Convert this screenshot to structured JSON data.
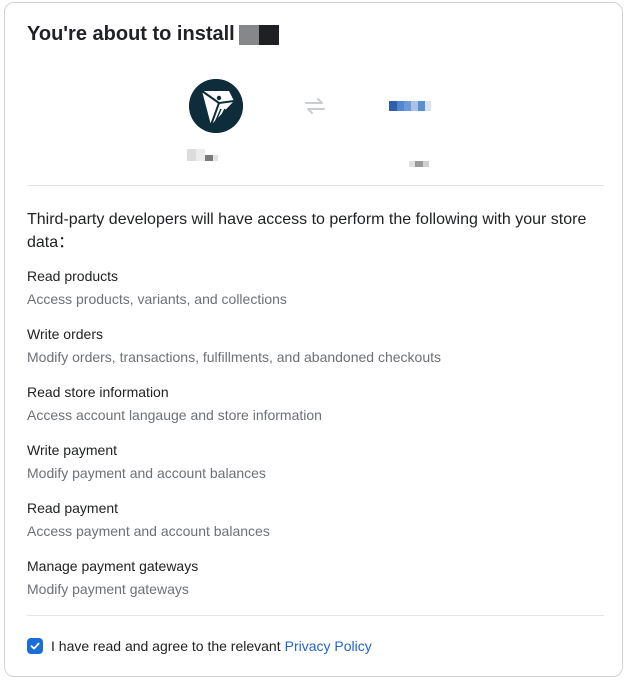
{
  "header": {
    "title": "You're about to install"
  },
  "icons": {
    "app_logo": "cube-logo-icon",
    "swap": "swap-arrows-icon",
    "check": "checkmark-icon"
  },
  "colors": {
    "accent": "#1a6ed8",
    "link": "#2563c9",
    "app_logo_bg": "#0f2c3a"
  },
  "intro": "Third-party developers will have access to perform the following with your store data：",
  "permissions": [
    {
      "title": "Read products",
      "description": "Access products, variants, and collections"
    },
    {
      "title": "Write orders",
      "description": "Modify orders, transactions, fulfillments, and abandoned checkouts"
    },
    {
      "title": "Read store information",
      "description": "Access account langauge and store information"
    },
    {
      "title": "Write payment",
      "description": "Modify payment and account balances"
    },
    {
      "title": "Read payment",
      "description": "Access payment and account balances"
    },
    {
      "title": "Manage payment gateways",
      "description": "Modify payment gateways"
    }
  ],
  "consent": {
    "checked": true,
    "text": "I have read and agree to the relevant",
    "link": "Privacy Policy"
  }
}
